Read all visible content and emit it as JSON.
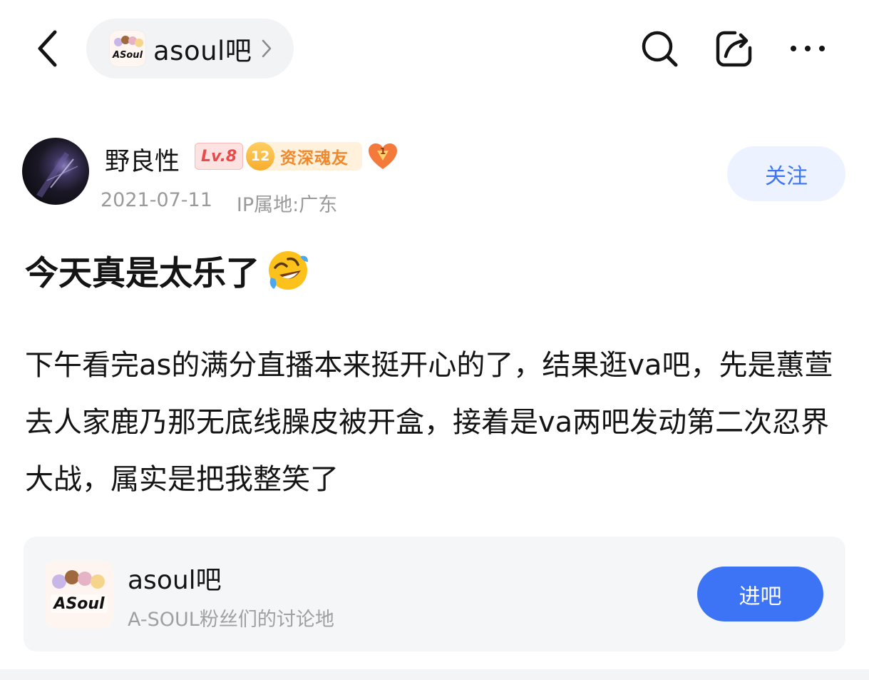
{
  "header": {
    "forum_name": "asoul吧",
    "icons": [
      "back-icon",
      "chevron-right-icon",
      "search-icon",
      "share-icon",
      "more-icon"
    ]
  },
  "author": {
    "name": "野良性",
    "level": "Lv.8",
    "rank_number": "12",
    "rank_title": "资深魂友",
    "heart_badge_number": "1",
    "date": "2021-07-11",
    "ip_location": "IP属地:广东",
    "follow_label": "关注"
  },
  "post": {
    "title": "今天真是太乐了",
    "title_emoji": "rolling-on-floor-laughing",
    "body": "下午看完as的满分直播本来挺开心的了，结果逛va吧，先是蕙萱去人家鹿乃那无底线臊皮被开盒，接着是va两吧发动第二次忍界大战，属实是把我整笑了"
  },
  "forum_card": {
    "name": "asoul吧",
    "description": "A-SOUL粉丝们的讨论地",
    "enter_label": "进吧",
    "logo_text": "ASoul"
  },
  "colors": {
    "accent_blue": "#3d74f5",
    "follow_bg": "#ecf2ff",
    "level_red": "#e94a4a",
    "rank_orange": "#f0892d",
    "meta_gray": "#9a9a9a"
  }
}
